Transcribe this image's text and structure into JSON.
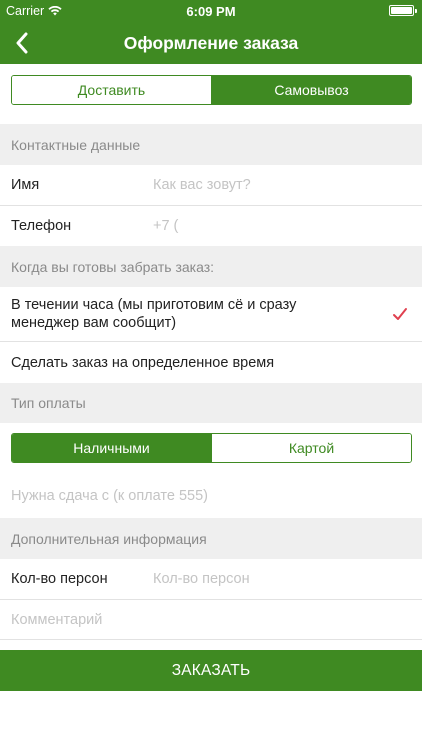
{
  "status_bar": {
    "carrier": "Carrier",
    "time": "6:09 PM"
  },
  "nav": {
    "title": "Оформление заказа",
    "back_icon": "chevron-left-icon"
  },
  "delivery_tabs": [
    {
      "label": "Доставить",
      "active": false
    },
    {
      "label": "Самовывоз",
      "active": true
    }
  ],
  "contact": {
    "header": "Контактные данные",
    "name_label": "Имя",
    "name_placeholder": "Как вас зовут?",
    "phone_label": "Телефон",
    "phone_value": "+7 ("
  },
  "pickup": {
    "header": "Когда вы готовы забрать заказ:",
    "option_asap": "В течении часа (мы приготовим сё и сразу менеджер вам сообщит)",
    "option_time": "Сделать заказ на определенное время",
    "selected": "asap"
  },
  "payment": {
    "header": "Тип оплаты",
    "tabs": [
      {
        "label": "Наличными",
        "active": true
      },
      {
        "label": "Картой",
        "active": false
      }
    ],
    "change_placeholder": "Нужна сдача с (к оплате 555)"
  },
  "extra": {
    "header": "Дополнительная информация",
    "persons_label": "Кол-во персон",
    "persons_placeholder": "Кол-во персон",
    "comment_placeholder": "Комментарий"
  },
  "order_button": "ЗАКАЗАТЬ",
  "colors": {
    "accent": "#3f8a22",
    "checkmark": "#e0404f",
    "section_bg": "#efefef"
  }
}
